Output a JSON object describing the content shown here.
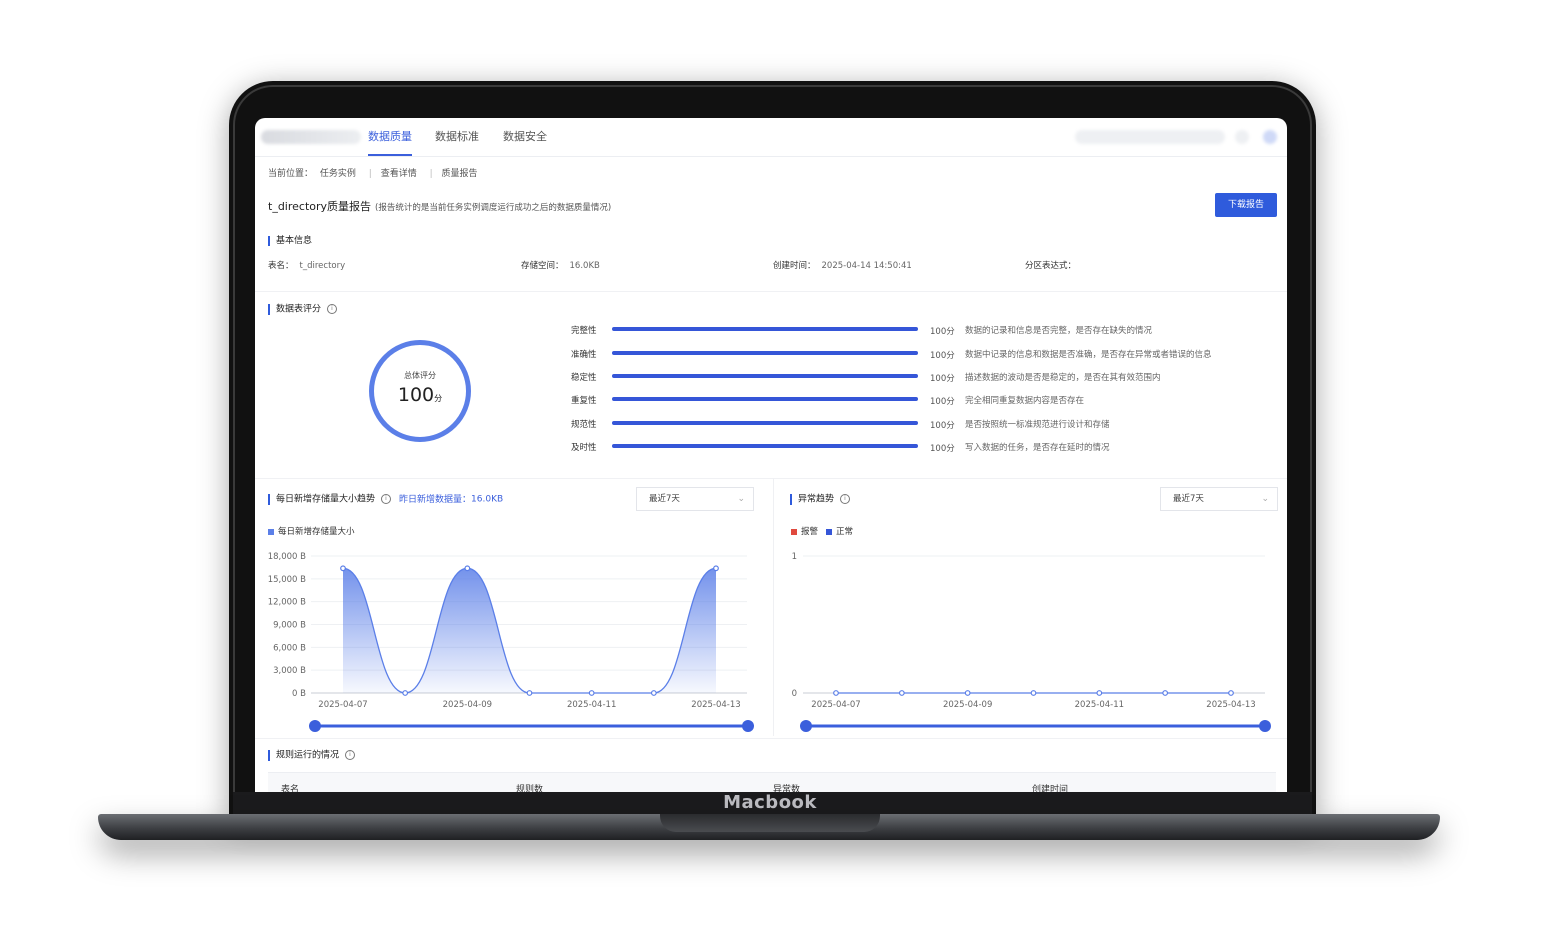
{
  "device": {
    "brand": "Macbook"
  },
  "nav": {
    "tabs": [
      "数据质量",
      "数据标准",
      "数据安全"
    ],
    "active": 0
  },
  "breadcrumb": {
    "prefix": "当前位置：",
    "items": [
      "任务实例",
      "查看详情",
      "质量报告"
    ]
  },
  "page": {
    "title": "t_directory质量报告",
    "subtitle": "(报告统计的是当前任务实例调度运行成功之后的数据质量情况)",
    "download_label": "下载报告"
  },
  "basic_info": {
    "title": "基本信息",
    "fields": [
      {
        "label": "表名：",
        "value": "t_directory"
      },
      {
        "label": "存储空间：",
        "value": "16.0KB"
      },
      {
        "label": "创建时间：",
        "value": "2025-04-14 14:50:41"
      },
      {
        "label": "分区表达式：",
        "value": ""
      }
    ]
  },
  "score": {
    "title": "数据表评分",
    "overall_label": "总体评分",
    "overall_value": "100",
    "overall_unit": "分",
    "metrics": [
      {
        "name": "完整性",
        "score": "100分",
        "level": 1.0,
        "desc": "数据的记录和信息是否完整，是否存在缺失的情况"
      },
      {
        "name": "准确性",
        "score": "100分",
        "level": 1.0,
        "desc": "数据中记录的信息和数据是否准确，是否存在异常或者错误的信息"
      },
      {
        "name": "稳定性",
        "score": "100分",
        "level": 1.0,
        "desc": "描述数据的波动是否是稳定的，是否在其有效范围内"
      },
      {
        "name": "重复性",
        "score": "100分",
        "level": 1.0,
        "desc": "完全相同重复数据内容是否存在"
      },
      {
        "name": "规范性",
        "score": "100分",
        "level": 1.0,
        "desc": "是否按照统一标准规范进行设计和存储"
      },
      {
        "name": "及时性",
        "score": "100分",
        "level": 1.0,
        "desc": "写入数据的任务，是否存在延时的情况"
      }
    ]
  },
  "trend": {
    "title": "每日新增存储量大小趋势",
    "yesterday_label": "昨日新增数据量：",
    "yesterday_value": "16.0KB",
    "range_select": "最近7天",
    "legend": "每日新增存储量大小",
    "color": "#5b7fe8"
  },
  "anomaly": {
    "title": "异常趋势",
    "range_select": "最近7天",
    "legend": [
      {
        "name": "报警",
        "color": "#e0493e"
      },
      {
        "name": "正常",
        "color": "#3556d8"
      }
    ]
  },
  "rules": {
    "title": "规则运行的情况",
    "columns": [
      "表名",
      "规则数",
      "异常数",
      "创建时间"
    ]
  },
  "chart_data": [
    {
      "type": "area",
      "title": "",
      "series": [
        {
          "name": "每日新增存储量大小",
          "values": [
            16384,
            0,
            16384,
            0,
            0,
            0,
            16384
          ]
        }
      ],
      "x": [
        "2025-04-07",
        "2025-04-08",
        "2025-04-09",
        "2025-04-10",
        "2025-04-11",
        "2025-04-12",
        "2025-04-13"
      ],
      "x_tick_labels": [
        "2025-04-07",
        "2025-04-09",
        "2025-04-11",
        "2025-04-13"
      ],
      "y_tick_labels": [
        "18,000 B",
        "15,000 B",
        "12,000 B",
        "9,000 B",
        "6,000 B",
        "3,000 B",
        "0 B"
      ],
      "ylim": [
        0,
        18000
      ],
      "grid": true
    },
    {
      "type": "line",
      "title": "",
      "series": [
        {
          "name": "正常",
          "values": [
            0,
            0,
            0,
            0,
            0,
            0,
            0
          ]
        }
      ],
      "x": [
        "2025-04-07",
        "2025-04-08",
        "2025-04-09",
        "2025-04-10",
        "2025-04-11",
        "2025-04-12",
        "2025-04-13"
      ],
      "x_tick_labels": [
        "2025-04-07",
        "2025-04-09",
        "2025-04-11",
        "2025-04-13"
      ],
      "y_tick_labels": [
        "1",
        "0"
      ],
      "ylim": [
        0,
        1
      ],
      "grid": true
    }
  ]
}
